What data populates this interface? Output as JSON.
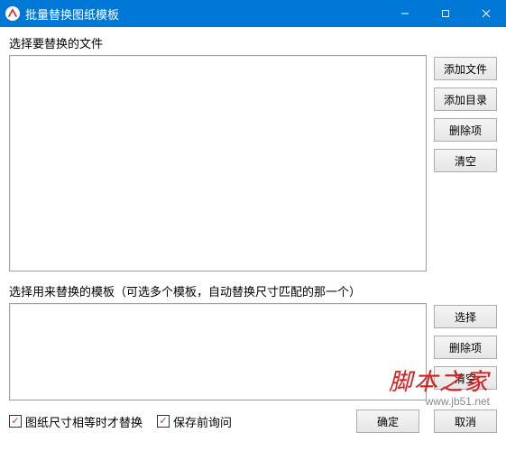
{
  "window": {
    "title": "批量替换图纸模板"
  },
  "section1": {
    "label": "选择要替换的文件",
    "buttons": {
      "add_file": "添加文件",
      "add_dir": "添加目录",
      "delete_item": "删除项",
      "clear": "清空"
    }
  },
  "section2": {
    "label": "选择用来替换的模板（可选多个模板，自动替换尺寸匹配的那一个）",
    "buttons": {
      "select": "选择",
      "delete_item": "删除项",
      "clear": "清空"
    }
  },
  "options": {
    "same_size_label": "图纸尺寸相等时才替换",
    "same_size_checked": "✓",
    "ask_before_save_label": "保存前询问",
    "ask_before_save_checked": "✓"
  },
  "actions": {
    "ok": "确定",
    "cancel": "取消"
  },
  "watermark": {
    "cn": "脚本之家",
    "url": "www.jb51.net"
  }
}
